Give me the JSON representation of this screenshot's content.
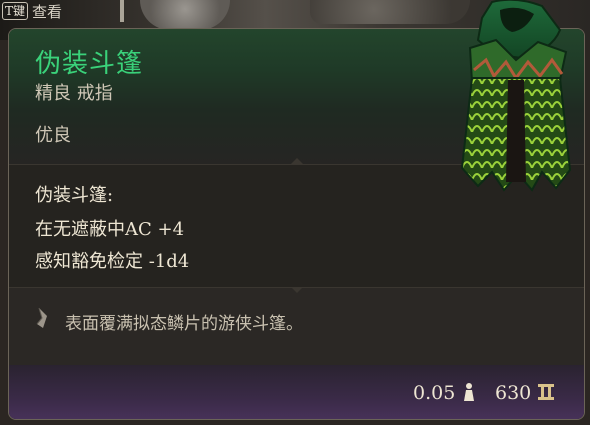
{
  "hud": {
    "key_label": "T键",
    "action_label": "查看"
  },
  "item": {
    "name": "伪装斗篷",
    "type_line": "精良 戒指",
    "rarity": "优良",
    "name_color": "#3ad27a",
    "enchantment": {
      "title": "伪装斗篷:",
      "lines": [
        "在无遮蔽中AC +4",
        "感知豁免检定 -1d4"
      ]
    },
    "description": "表面覆满拟态鳞片的游侠斗篷。",
    "weight": "0.05",
    "price": "630",
    "icons": {
      "description": "quill-icon",
      "weight": "weight-icon",
      "price": "gold-coin-icon",
      "portrait": "cloak-icon"
    }
  }
}
